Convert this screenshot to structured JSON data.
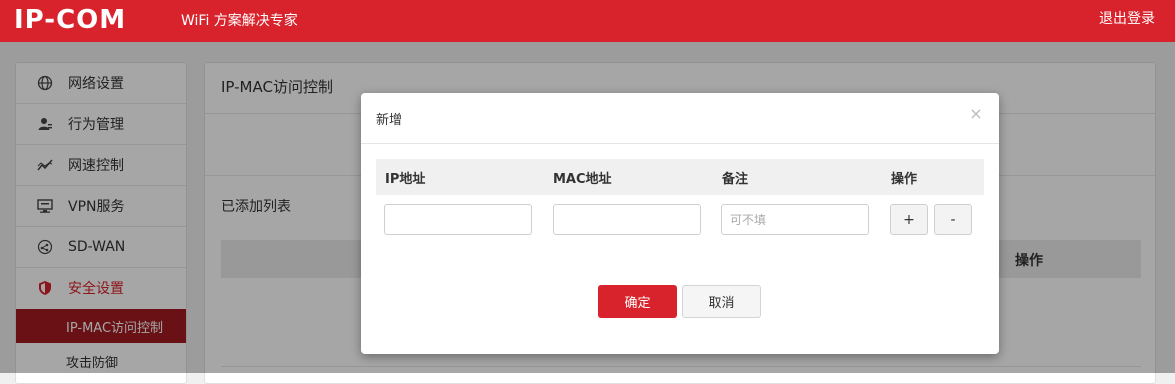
{
  "header": {
    "logo": "IP-COM",
    "tagline": "WiFi 方案解决专家",
    "logout": "退出登录",
    "brand_color": "#d9232c"
  },
  "sidebar": {
    "items": [
      {
        "label": "网络设置",
        "icon": "globe-icon"
      },
      {
        "label": "行为管理",
        "icon": "user-manage-icon"
      },
      {
        "label": "网速控制",
        "icon": "speed-chart-icon"
      },
      {
        "label": "VPN服务",
        "icon": "monitor-icon"
      },
      {
        "label": "SD-WAN",
        "icon": "network-nodes-icon"
      },
      {
        "label": "安全设置",
        "icon": "shield-icon",
        "active": true
      }
    ],
    "sub_items": [
      {
        "label": "IP-MAC访问控制",
        "active": true
      },
      {
        "label": "攻击防御"
      }
    ]
  },
  "main": {
    "title": "IP-MAC访问控制",
    "added_list_label": "已添加列表",
    "table_op_header": "操作"
  },
  "modal": {
    "title": "新增",
    "columns": [
      "IP地址",
      "MAC地址",
      "备注",
      "操作"
    ],
    "row": {
      "ip_value": "",
      "mac_value": "",
      "note_placeholder": "可不填",
      "add_label": "+",
      "remove_label": "-"
    },
    "confirm_label": "确定",
    "cancel_label": "取消"
  }
}
